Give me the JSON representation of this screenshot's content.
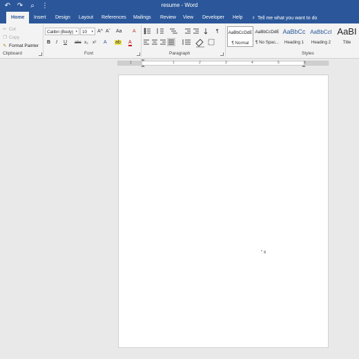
{
  "window": {
    "title": "resume - Word",
    "qat": {
      "undo_icon": "undo-icon",
      "redo_icon": "redo-icon",
      "preview_icon": "print-preview-icon",
      "customize_icon": "qat-customize-icon"
    }
  },
  "tabs": [
    {
      "label": "Home",
      "active": true
    },
    {
      "label": "Insert"
    },
    {
      "label": "Design"
    },
    {
      "label": "Layout"
    },
    {
      "label": "References"
    },
    {
      "label": "Mailings"
    },
    {
      "label": "Review"
    },
    {
      "label": "View"
    },
    {
      "label": "Developer"
    },
    {
      "label": "Help"
    }
  ],
  "tell_me": {
    "icon": "lightbulb-icon",
    "text": "Tell me what you want to do"
  },
  "clipboard": {
    "label": "Clipboard",
    "cut": "Cut",
    "copy": "Copy",
    "format_painter": "Format Painter"
  },
  "font": {
    "label": "Font",
    "font_name": "Calibri (Body)",
    "font_size": "10",
    "grow": "A^",
    "shrink": "Aˇ",
    "change_case": "Aa",
    "clear": "A",
    "bold": "B",
    "italic": "I",
    "underline": "U",
    "strikethrough": "abc",
    "subscript": "x₂",
    "superscript": "x²",
    "text_effects": "A",
    "highlight": "ab",
    "font_color": "A"
  },
  "paragraph": {
    "label": "Paragraph",
    "bullets_icon": "bullets-icon",
    "numbering_icon": "numbering-icon",
    "multilevel_icon": "multilevel-list-icon",
    "decrease_indent_icon": "decrease-indent-icon",
    "increase_indent_icon": "increase-indent-icon",
    "sort_icon": "sort-icon",
    "show_marks": "¶",
    "align_left_icon": "align-left-icon",
    "center_icon": "align-center-icon",
    "align_right_icon": "align-right-icon",
    "justify_icon": "justify-icon",
    "line_spacing_icon": "line-spacing-icon",
    "shading_icon": "shading-icon",
    "borders_icon": "borders-icon"
  },
  "styles": {
    "label": "Styles",
    "items": [
      {
        "preview": "AaBbCcDdE",
        "name": "¶ Normal",
        "selected": true
      },
      {
        "preview": "AaBbCcDdE",
        "name": "¶ No Spac..."
      },
      {
        "preview": "AaBbCc",
        "name": "Heading 1"
      },
      {
        "preview": "AaBbCcI",
        "name": "Heading 2"
      },
      {
        "preview": "AaBI",
        "name": "Title"
      }
    ]
  },
  "ruler": {
    "numbers": [
      "1",
      "1",
      "2",
      "3",
      "4",
      "5",
      "6"
    ]
  },
  "document": {
    "visible_mark": "\" ≡"
  },
  "colors": {
    "accent": "#2b579a",
    "ribbon_bg": "#f3f3f3",
    "workspace_bg": "#e9e9e9",
    "highlight": "#f1e34a",
    "font_color": "#cc0000"
  }
}
